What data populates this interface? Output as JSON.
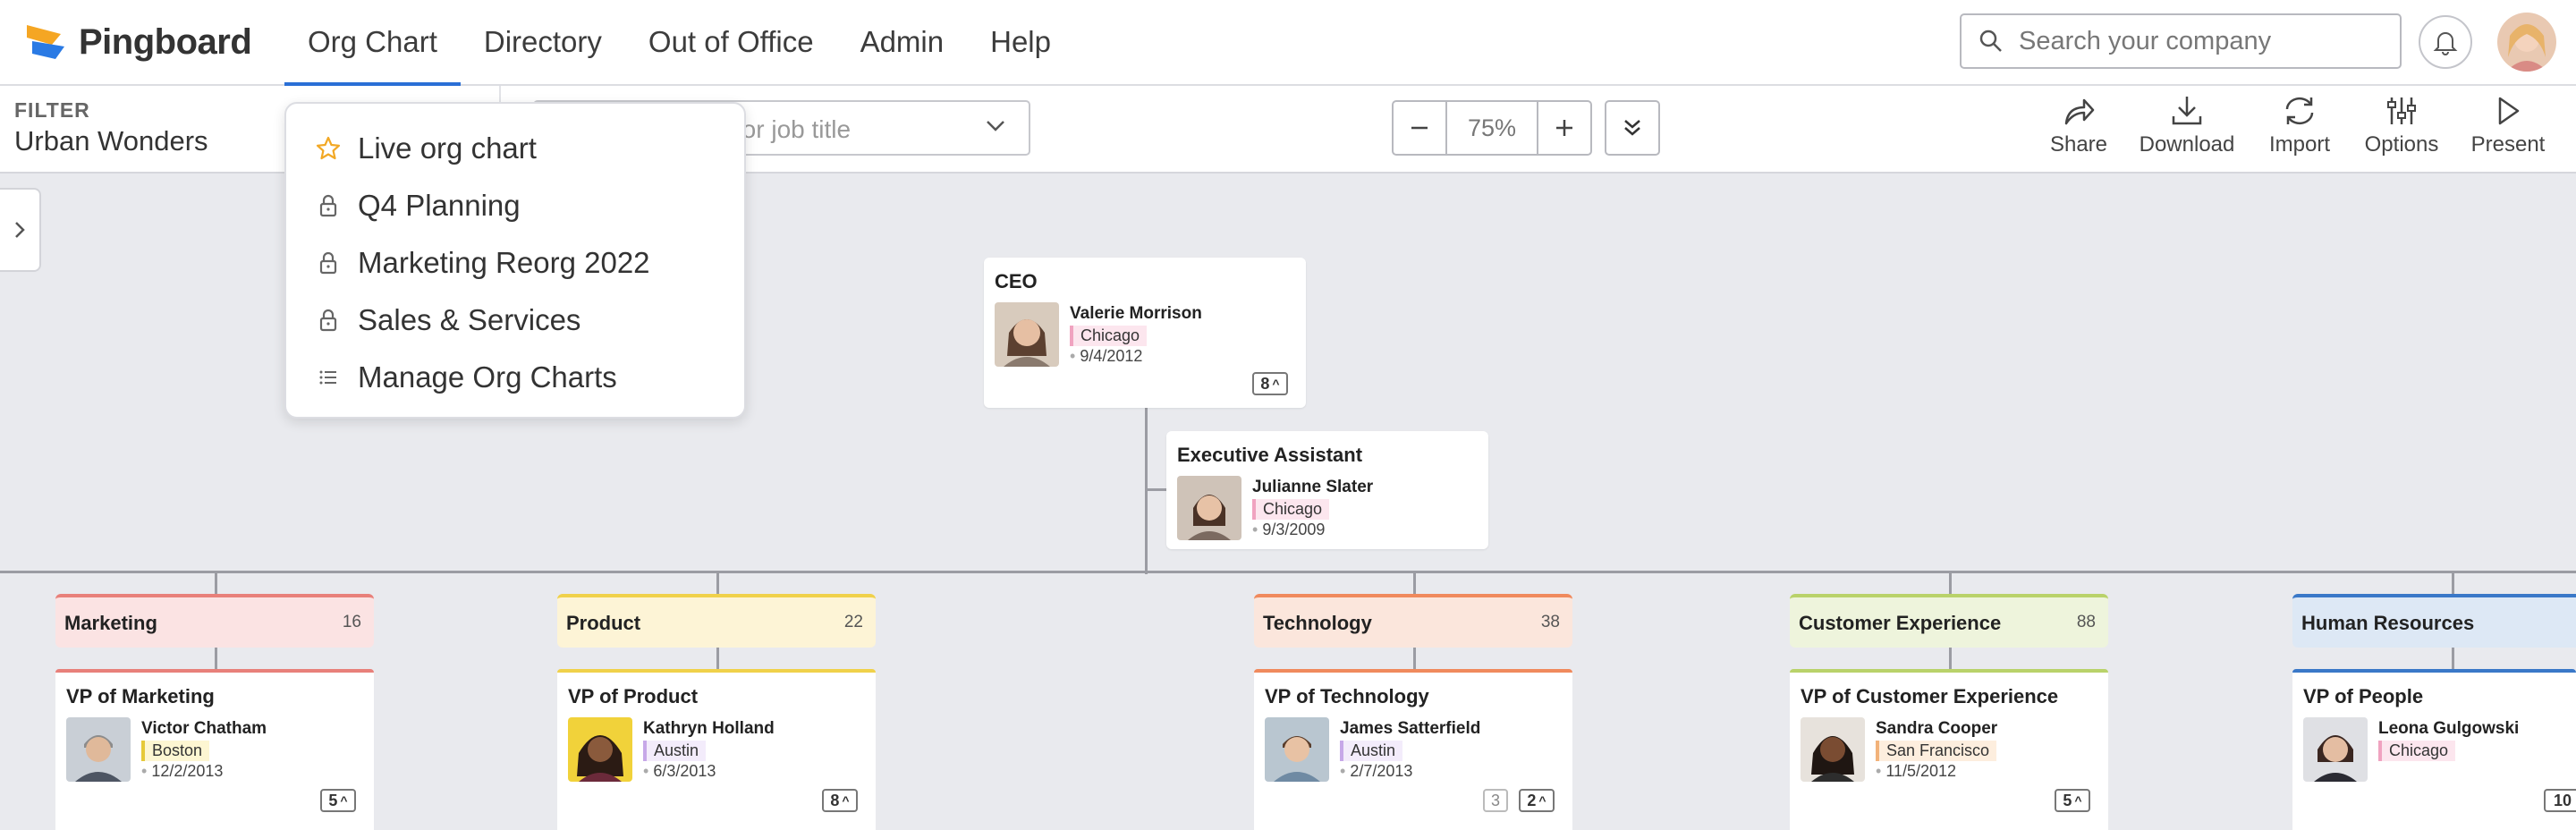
{
  "app": {
    "name": "Pingboard"
  },
  "nav": [
    {
      "label": "Org Chart"
    },
    {
      "label": "Directory"
    },
    {
      "label": "Out of Office"
    },
    {
      "label": "Admin"
    },
    {
      "label": "Help"
    }
  ],
  "search": {
    "placeholder": "Search your company"
  },
  "toolbar": {
    "filter_label": "FILTER",
    "filter_value": "Urban Wonders",
    "person_search_placeholder": "Search by name or job title",
    "zoom_level": "75%",
    "tools": [
      {
        "label": "Share",
        "icon": "share-icon"
      },
      {
        "label": "Download",
        "icon": "download-icon"
      },
      {
        "label": "Import",
        "icon": "import-icon"
      },
      {
        "label": "Options",
        "icon": "options-icon"
      },
      {
        "label": "Present",
        "icon": "present-icon"
      }
    ]
  },
  "dropdown": {
    "items": [
      {
        "label": "Live org chart",
        "icon": "star-icon"
      },
      {
        "label": "Q4 Planning",
        "icon": "lock-icon"
      },
      {
        "label": "Marketing Reorg 2022",
        "icon": "lock-icon"
      },
      {
        "label": "Sales & Services",
        "icon": "lock-icon"
      },
      {
        "label": "Manage Org Charts",
        "icon": "list-icon"
      }
    ]
  },
  "ceo": {
    "title": "CEO",
    "name": "Valerie Morrison",
    "location": "Chicago",
    "date": "9/4/2012",
    "reports": "8"
  },
  "assistant": {
    "title": "Executive Assistant",
    "name": "Julianne Slater",
    "location": "Chicago",
    "date": "9/3/2009"
  },
  "departments": [
    {
      "name": "Marketing",
      "count": "16",
      "color": "#e8807a",
      "bg": "#fbe3e3",
      "vp": {
        "title": "VP of Marketing",
        "name": "Victor Chatham",
        "location": "Boston",
        "loc_color": "#e6c93a",
        "loc_bg": "#fdf6d2",
        "date": "12/2/2013",
        "reports": "5"
      }
    },
    {
      "name": "Product",
      "count": "22",
      "color": "#f0d14a",
      "bg": "#fdf4d6",
      "vp": {
        "title": "VP of Product",
        "name": "Kathryn Holland",
        "location": "Austin",
        "loc_color": "#c7a8e8",
        "loc_bg": "#f3ecfb",
        "date": "6/3/2013",
        "reports": "8"
      }
    },
    {
      "name": "Technology",
      "count": "38",
      "color": "#f08a5d",
      "bg": "#fbe6dc",
      "vp": {
        "title": "VP of Technology",
        "name": "James Satterfield",
        "location": "Austin",
        "loc_color": "#c7a8e8",
        "loc_bg": "#f3ecfb",
        "date": "2/7/2013",
        "reports_minor": "3",
        "reports": "2"
      }
    },
    {
      "name": "Customer Experience",
      "count": "88",
      "color": "#b9d26a",
      "bg": "#eef4dc",
      "vp": {
        "title": "VP of Customer Experience",
        "name": "Sandra Cooper",
        "location": "San Francisco",
        "loc_color": "#f2b27a",
        "loc_bg": "#fdeede",
        "date": "11/5/2012",
        "reports": "5"
      }
    },
    {
      "name": "Human Resources",
      "count": "",
      "color": "#3a78c8",
      "bg": "#dde8f5",
      "vp": {
        "title": "VP of People",
        "name": "Leona Gulgowski",
        "location": "Chicago",
        "loc_color": "#f0a3c0",
        "loc_bg": "#fce6ee",
        "date": "",
        "reports": "10"
      }
    }
  ],
  "colors": {
    "accent": "#2a6fd6",
    "chicago_loc": "#f0a3c0",
    "chicago_bg": "#fce6ee"
  }
}
